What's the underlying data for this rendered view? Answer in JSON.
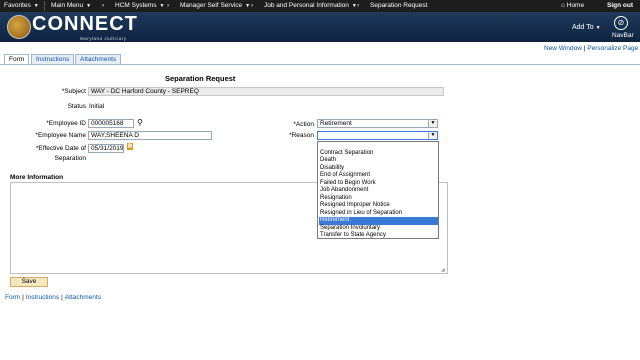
{
  "topbar": {
    "favorites": "Favorites",
    "main_menu": "Main Menu",
    "crumb1": "HCM Systems",
    "crumb2": "Manager Self Service",
    "crumb3": "Job and Personal Information",
    "crumb4": "Separation Request",
    "home": "Home",
    "signout": "Sign out"
  },
  "banner": {
    "logo_text": "CONNECT",
    "logo_sub": "Maryland Judiciary",
    "add_to": "Add To",
    "navbar": "NavBar"
  },
  "links": {
    "new_window": "New Window",
    "personalize": "Personalize Page"
  },
  "tabs": [
    "Form",
    "Instructions",
    "Attachments"
  ],
  "form": {
    "title": "Separation Request",
    "subject_label": "*Subject",
    "subject_value": "WAY - DC Harford County - SEPREQ",
    "status_label": "Status",
    "status_value": "Initial",
    "employee_id_label": "*Employee ID",
    "employee_id_value": "000005168",
    "employee_name_label": "*Employee Name",
    "employee_name_value": "WAY,SHEENA D",
    "effective_date_label": "*Effective Date of",
    "effective_date_label2": "Separation",
    "effective_date_value": "05/31/2019",
    "action_label": "*Action",
    "action_value": "Retirement",
    "reason_label": "*Reason",
    "reason_value": "",
    "more_info_label": "More Information",
    "save": "Save"
  },
  "reason_options": [
    "",
    "Contract Separation",
    "Death",
    "Disability",
    "End of Assignment",
    "Failed to Begin Work",
    "Job Abandonment",
    "Resignation",
    "Resigned Improper Notice",
    "Resigned in Lieu of Separation",
    "Retirement",
    "Separation Involuntary",
    "Transfer to State Agency"
  ],
  "selected_option": "Retirement",
  "footer": {
    "form": "Form",
    "instructions": "Instructions",
    "attachments": "Attachments"
  }
}
